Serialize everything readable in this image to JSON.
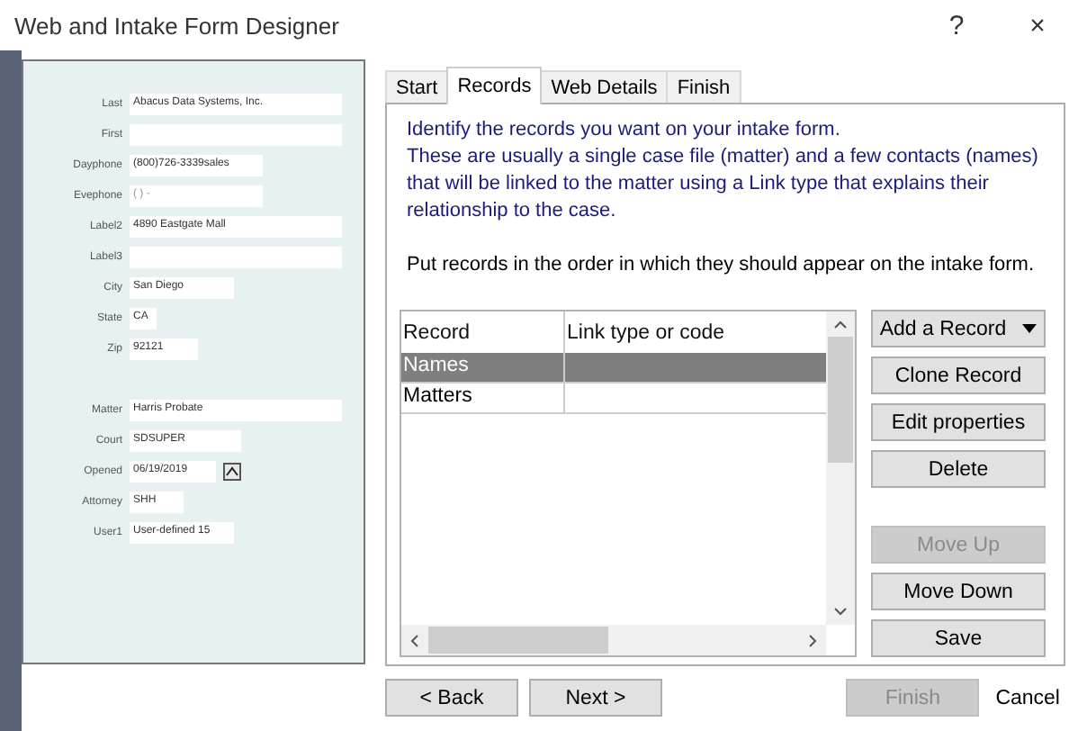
{
  "window": {
    "title": "Web and Intake Form Designer",
    "buttons": [
      "?",
      "×"
    ]
  },
  "preview": {
    "fields": [
      {
        "label": "Last",
        "value": "Abacus Data Systems, Inc.",
        "kind": "text"
      },
      {
        "label": "First",
        "kind": "text"
      },
      {
        "label": "Dayphone",
        "value": "(800)726-3339sales",
        "kind": "text"
      },
      {
        "label": "Evephone",
        "placeholder": "(   )   -",
        "kind": "text"
      },
      {
        "label": "Label2",
        "value": "4890 Eastgate Mall",
        "kind": "text"
      },
      {
        "label": "Label3",
        "kind": "text"
      },
      {
        "label": "City",
        "value": "San Diego",
        "kind": "text"
      },
      {
        "label": "State",
        "value": "CA",
        "kind": "text"
      },
      {
        "label": "Zip",
        "value": "92121",
        "kind": "text"
      },
      {
        "label": "Matter",
        "value": "Harris Probate",
        "kind": "text"
      },
      {
        "label": "Court",
        "value": "SDSUPER",
        "kind": "text"
      },
      {
        "label": "Opened",
        "value": "06/19/2019",
        "kind": "date"
      },
      {
        "label": "Attorney",
        "value": "SHH",
        "kind": "text"
      },
      {
        "label": "User1",
        "value": "User-defined 15",
        "kind": "text"
      }
    ]
  },
  "tabs": [
    {
      "label": "Start",
      "selected": false
    },
    {
      "label": "Records",
      "selected": true
    },
    {
      "label": "Web Details",
      "selected": false
    },
    {
      "label": "Finish",
      "selected": false
    }
  ],
  "instructions": [
    {
      "text": "Identify the records you want on your intake form.\nThese are usually a single case file (matter) and a few contacts (names) that will be linked to the matter using a Link type that explains their relationship to the case.",
      "kind": "info"
    },
    {
      "text": "Put records in the order in which they should appear on the intake form.",
      "kind": "plain"
    }
  ],
  "table": {
    "columns": [
      "Record",
      "Link type or code"
    ],
    "rows": [
      {
        "cells": [
          "Names"
        ],
        "selected": true
      },
      {
        "cells": [
          "Matters"
        ],
        "selected": false
      }
    ]
  },
  "side_buttons": [
    {
      "label": "Add a Record",
      "dropdown": true,
      "disabled": false
    },
    {
      "label": "Clone Record",
      "dropdown": false,
      "disabled": false
    },
    {
      "label": "Edit properties",
      "dropdown": false,
      "disabled": false
    },
    {
      "label": "Delete",
      "dropdown": false,
      "disabled": false
    },
    {
      "label": "Move Up",
      "dropdown": false,
      "disabled": true
    },
    {
      "label": "Move Down",
      "dropdown": false,
      "disabled": false
    },
    {
      "label": "Save",
      "dropdown": false,
      "disabled": false
    }
  ],
  "footer": [
    {
      "label": "< Back",
      "kind": "button",
      "disabled": false
    },
    {
      "label": "Next >",
      "kind": "button",
      "disabled": false
    },
    {
      "label": "Finish",
      "kind": "button",
      "disabled": true
    },
    {
      "label": "Cancel",
      "kind": "link",
      "disabled": false
    }
  ]
}
